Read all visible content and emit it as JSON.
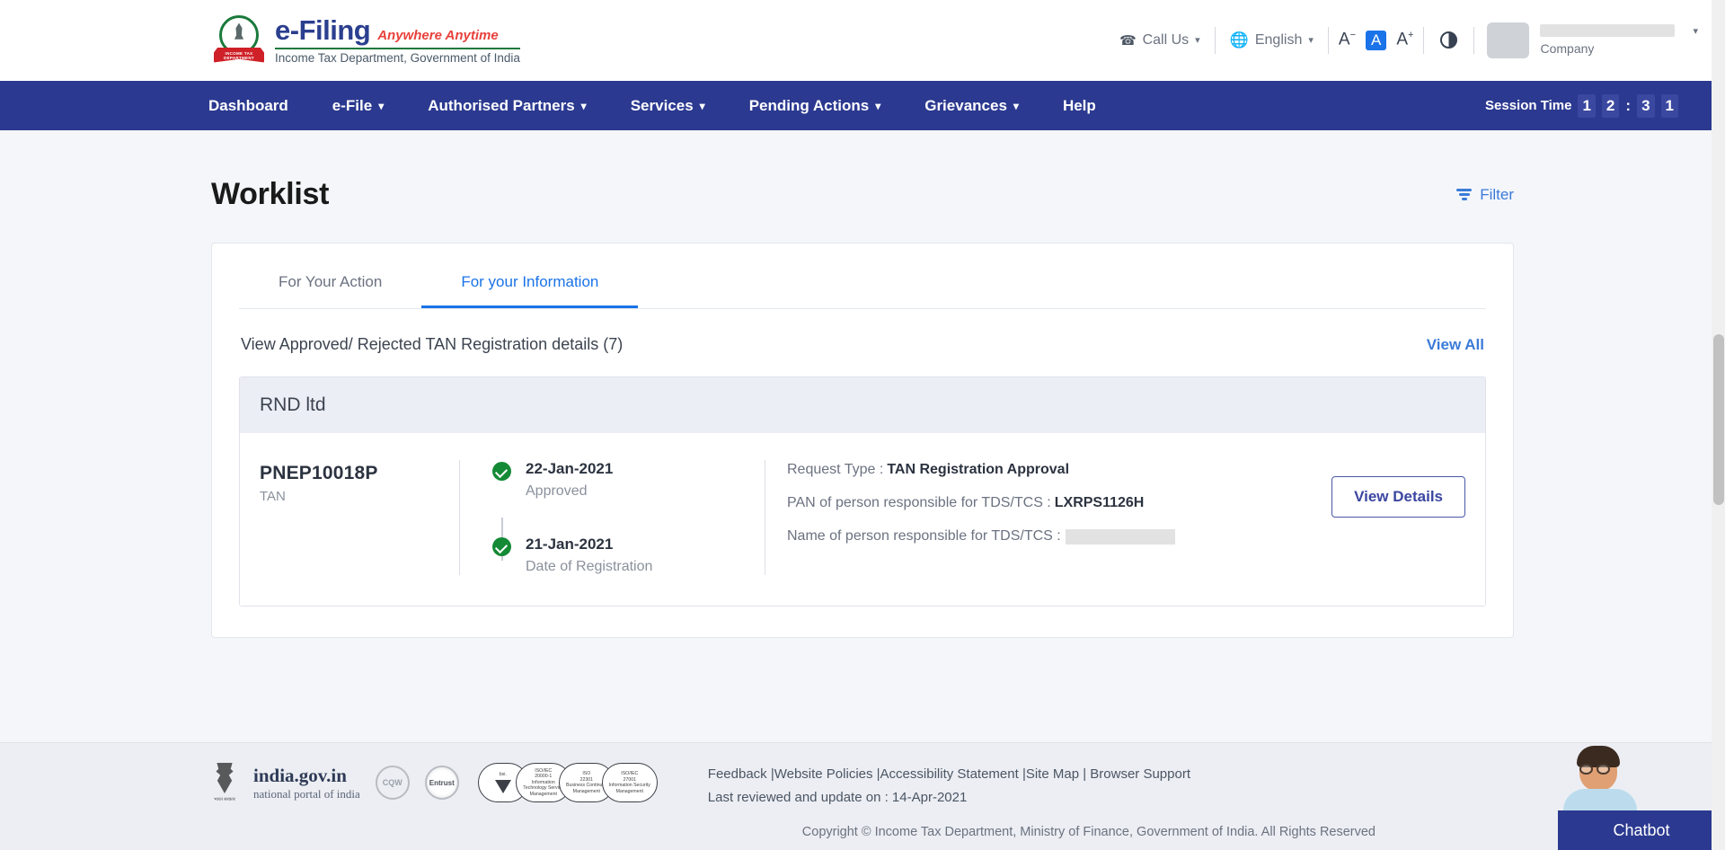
{
  "header": {
    "brand": {
      "title": "e-Filing",
      "tagline": "Anywhere Anytime",
      "subtitle": "Income Tax Department, Government of India",
      "emblem_ribbon": "INCOME TAX DEPARTMENT"
    },
    "tools": {
      "call_us": "Call Us",
      "language": "English",
      "font_decrease": "A",
      "font_normal": "A",
      "font_increase": "A",
      "contrast": "contrast-toggle"
    },
    "account": {
      "name": "",
      "role": "Company"
    }
  },
  "nav": {
    "items": [
      {
        "label": "Dashboard",
        "has_caret": false
      },
      {
        "label": "e-File",
        "has_caret": true
      },
      {
        "label": "Authorised Partners",
        "has_caret": true
      },
      {
        "label": "Services",
        "has_caret": true
      },
      {
        "label": "Pending Actions",
        "has_caret": true
      },
      {
        "label": "Grievances",
        "has_caret": true
      },
      {
        "label": "Help",
        "has_caret": false
      }
    ],
    "session": {
      "label": "Session Time",
      "d1": "1",
      "d2": "2",
      "sep": ":",
      "d3": "3",
      "d4": "1"
    }
  },
  "page": {
    "title": "Worklist",
    "filter_label": "Filter"
  },
  "tabs": [
    {
      "label": "For Your Action",
      "active": false
    },
    {
      "label": "For your Information",
      "active": true
    }
  ],
  "section": {
    "title": "View Approved/ Rejected TAN Registration details (7)",
    "view_all": "View All"
  },
  "entity": {
    "name": "RND ltd",
    "tan_number": "PNEP10018P",
    "tan_label": "TAN",
    "timeline": [
      {
        "date": "22-Jan-2021",
        "status": "Approved"
      },
      {
        "date": "21-Jan-2021",
        "status": "Date of Registration"
      }
    ],
    "details": [
      {
        "label": "Request Type :",
        "value": "TAN Registration Approval",
        "redacted": false
      },
      {
        "label": "PAN of person responsible for TDS/TCS :",
        "value": "LXRPS1126H",
        "redacted": false
      },
      {
        "label": "Name of person responsible for TDS/TCS :",
        "value": "",
        "redacted": true
      }
    ],
    "action_label": "View Details"
  },
  "footer": {
    "india_gov_line1": "india.gov.in",
    "india_gov_line2": "national portal of india",
    "badges": [
      {
        "label": "CQW"
      },
      {
        "label": "Entrust"
      }
    ],
    "iso": [
      {
        "line1": "bsi.",
        "line2": "",
        "line3": ""
      },
      {
        "line1": "ISO/IEC",
        "line2": "20000-1",
        "line3": "Information Technology Service Management"
      },
      {
        "line1": "ISO",
        "line2": "22301",
        "line3": "Business Continuity Management"
      },
      {
        "line1": "ISO/IEC",
        "line2": "27001",
        "line3": "Information Security Management"
      }
    ],
    "links": "Feedback |Website Policies |Accessibility Statement |Site Map | Browser Support",
    "last_reviewed": "Last reviewed and update on : 14-Apr-2021",
    "copyright": "Copyright © Income Tax Department, Ministry of Finance, Government of India. All Rights Reserved"
  },
  "chatbot": {
    "label": "Chatbot"
  },
  "colors": {
    "nav_blue": "#2b3990",
    "link_blue": "#3b7bd8",
    "active_tab_blue": "#1a73e8",
    "success_green": "#158a36",
    "page_bg": "#f4f6fa",
    "footer_bg": "#eceef3"
  }
}
